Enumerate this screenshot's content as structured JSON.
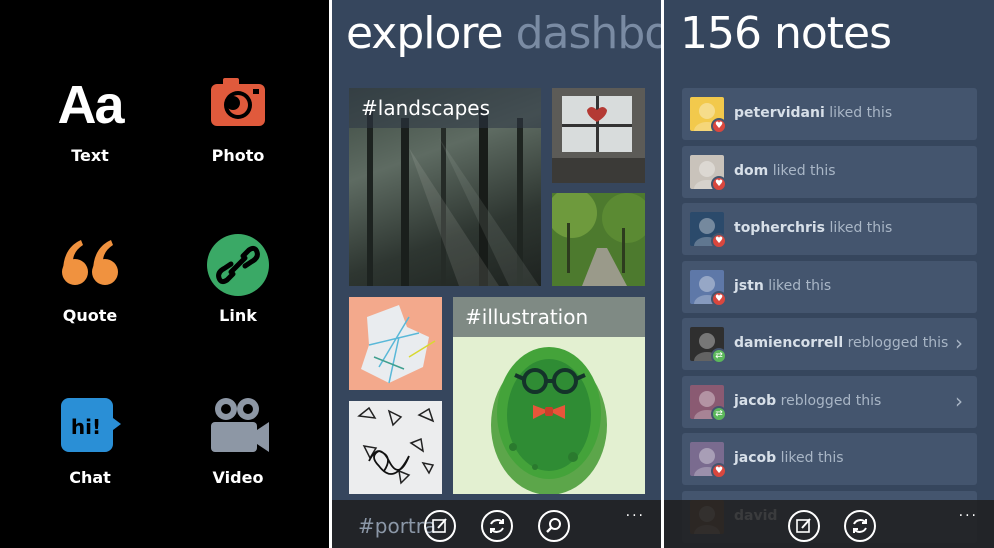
{
  "post_types": [
    {
      "label": "Text",
      "glyph": "Aa",
      "icon": "text-aa-icon",
      "color": "#ffffff"
    },
    {
      "label": "Photo",
      "icon": "camera-icon",
      "color": "#e05a3c"
    },
    {
      "label": "Quote",
      "glyph": "“",
      "icon": "quote-icon",
      "color": "#f0923f"
    },
    {
      "label": "Link",
      "icon": "link-icon",
      "color": "#3aa966"
    },
    {
      "label": "Chat",
      "glyph": "hi!",
      "icon": "chat-icon",
      "color": "#2a8fd6"
    },
    {
      "label": "Video",
      "icon": "video-camera-icon",
      "color": "#8d97a5"
    }
  ],
  "explore": {
    "title": "explore",
    "next_title": "dashbo",
    "tag_landscapes": "#landscapes",
    "tag_illustration": "#illustration",
    "tag_portraits": "#portra",
    "more": "..."
  },
  "notes": {
    "title": "156 notes",
    "items": [
      {
        "user": "petervidani",
        "action": "liked this",
        "badge": "heart",
        "chevron": false
      },
      {
        "user": "dom",
        "action": "liked this",
        "badge": "heart",
        "chevron": false
      },
      {
        "user": "topherchris",
        "action": "liked this",
        "badge": "heart",
        "chevron": false
      },
      {
        "user": "jstn",
        "action": "liked this",
        "badge": "heart",
        "chevron": false
      },
      {
        "user": "damiencorrell",
        "action": "reblogged this",
        "badge": "reblog",
        "chevron": true
      },
      {
        "user": "jacob",
        "action": "reblogged this",
        "badge": "reblog",
        "chevron": true
      },
      {
        "user": "jacob",
        "action": "liked this",
        "badge": "heart",
        "chevron": false
      },
      {
        "user": "david",
        "action": "",
        "badge": "",
        "chevron": false
      }
    ],
    "more": "..."
  },
  "colors": {
    "heart": "#d9473e",
    "reblog": "#5bb85b",
    "panel_bg": "#36465d",
    "card_bg": "#44556e"
  }
}
